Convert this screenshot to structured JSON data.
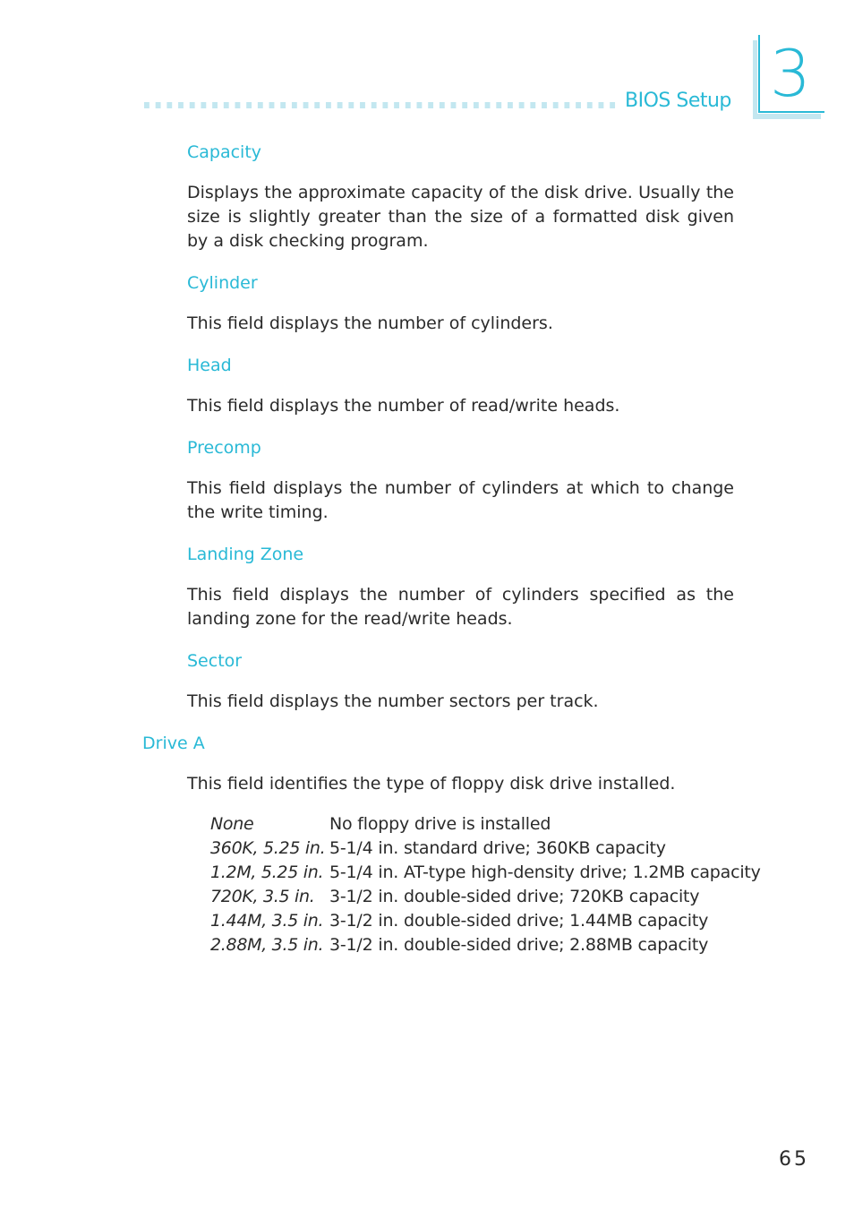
{
  "header": {
    "section_title": "BIOS Setup",
    "chapter_number": "3",
    "accent_color": "#29b9d6",
    "light_accent_color": "#c3e7f0"
  },
  "sections": [
    {
      "heading": "Capacity",
      "body": "Displays the approximate capacity of the disk drive. Usually the size is slightly greater than the size of a formatted disk given by a disk checking program."
    },
    {
      "heading": "Cylinder",
      "body": "This field displays the number of cylinders."
    },
    {
      "heading": "Head",
      "body": "This field displays the number of read/write heads."
    },
    {
      "heading": "Precomp",
      "body": "This field displays the number of cylinders at which to change the write timing."
    },
    {
      "heading": "Landing Zone",
      "body": "This field displays the number of cylinders specified as the landing zone for the read/write heads."
    },
    {
      "heading": "Sector",
      "body": "This field displays the number sectors per track."
    }
  ],
  "drive_a": {
    "heading": "Drive A",
    "body": "This field identifies the type of floppy disk drive installed.",
    "options": [
      {
        "key": "None",
        "desc": "No floppy drive is installed"
      },
      {
        "key": "360K, 5.25 in.",
        "desc": "5-1/4 in. standard drive; 360KB capacity"
      },
      {
        "key": "1.2M, 5.25 in.",
        "desc": "5-1/4 in. AT-type high-density drive; 1.2MB capacity"
      },
      {
        "key": "720K, 3.5 in.",
        "desc": "3-1/2 in. double-sided drive; 720KB capacity"
      },
      {
        "key": "1.44M, 3.5 in.",
        "desc": "3-1/2 in. double-sided drive; 1.44MB capacity"
      },
      {
        "key": "2.88M, 3.5 in.",
        "desc": "3-1/2 in. double-sided drive; 2.88MB capacity"
      }
    ]
  },
  "footer": {
    "page_number": "65"
  }
}
